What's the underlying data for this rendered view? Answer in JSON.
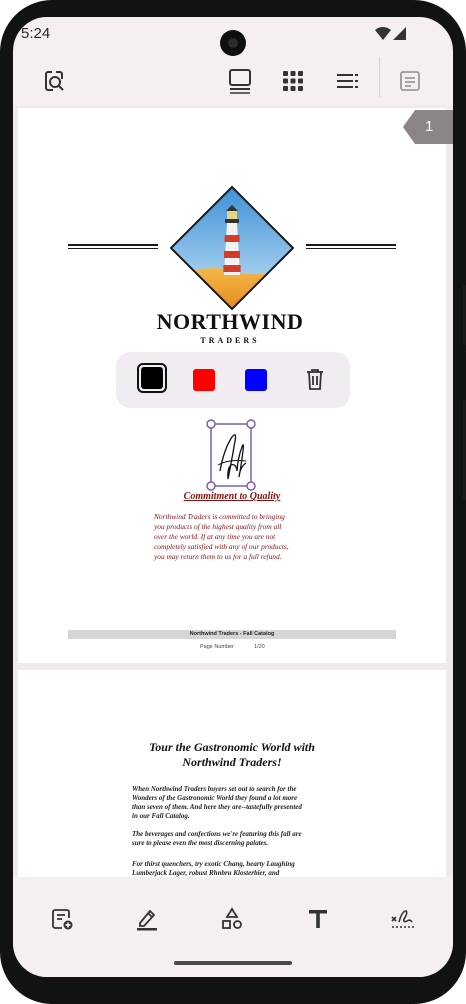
{
  "status_bar": {
    "time": "5:24",
    "icons": [
      "wifi-icon",
      "cellular-icon"
    ]
  },
  "toolbar": {
    "icons": [
      "document-search-icon",
      "single-page-view-icon",
      "grid-view-icon",
      "list-view-icon",
      "form-icon"
    ]
  },
  "viewer": {
    "page_badge": "1",
    "page1": {
      "brand": "NORTHWIND",
      "brand_sub": "TRADERS",
      "commitment_title": "Commitment to Quality",
      "commitment_lines": [
        "Northwind Traders is committed to bringing",
        "you products of the highest quality from all",
        "over the world. If at any time you are not",
        "completely satisfied with any of our products,",
        "you may return them to us for a full refund."
      ],
      "footer": "Northwind Traders - Fall Catalog",
      "page_number_label": "Page Number",
      "page_number_value": "1/20"
    },
    "page2": {
      "title_lines": [
        "Tour the Gastronomic World with",
        "Northwind Traders!"
      ],
      "para1_lines": [
        "When Northwind Traders buyers set out to search for the",
        "Wonders of the Gastronomic World they found a lot more",
        "than seven of them. And here they are--tastefully presented",
        "in our Fall Catalog."
      ],
      "para2_lines": [
        "The beverages and confections we're featuring this fall are",
        "sure to please even the most discerning palates."
      ],
      "para3_lines": [
        "For thirst quenchers, try exotic Chang, hearty Laughing",
        "Lumberjack Lager, robust Rhnbru Klosterbier, and"
      ]
    }
  },
  "color_picker": {
    "colors": [
      "#000000",
      "#ff0000",
      "#0000ff"
    ],
    "selected": "#000000"
  },
  "bottom_toolbar": {
    "icons": [
      "add-note-icon",
      "highlight-icon",
      "shapes-icon",
      "text-icon",
      "signature-icon"
    ]
  }
}
